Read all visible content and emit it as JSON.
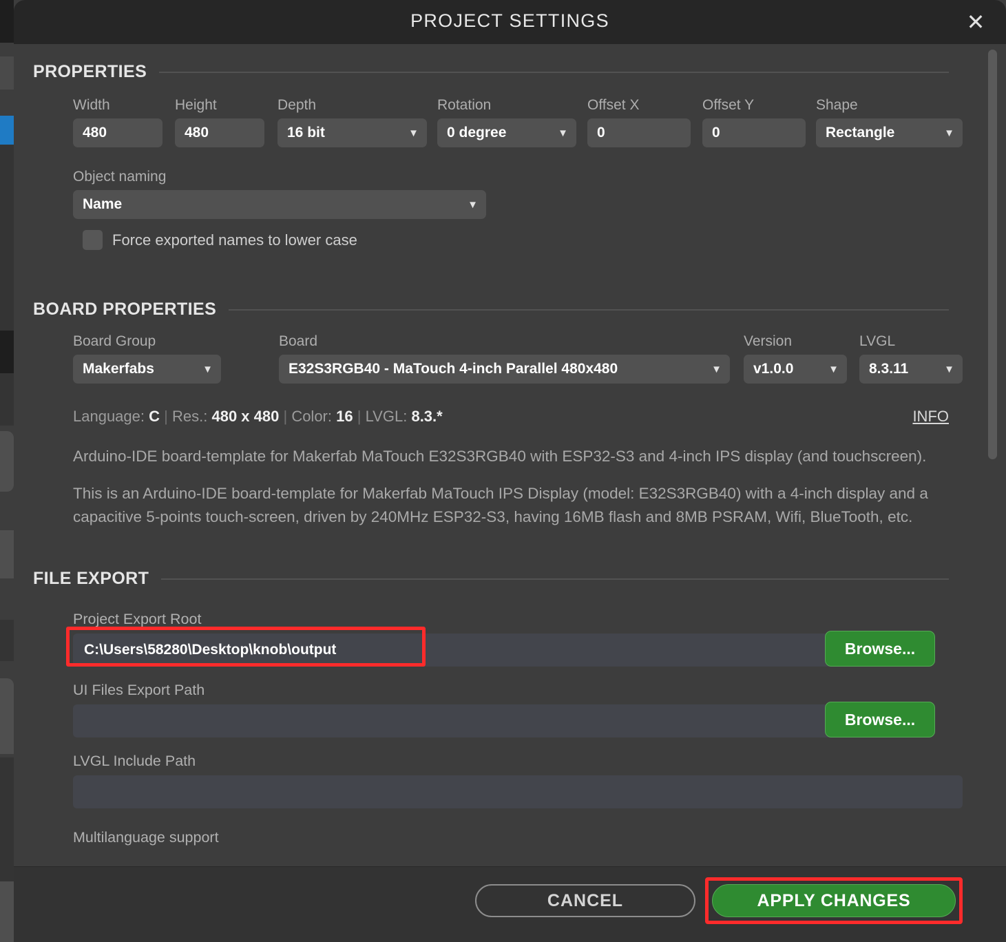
{
  "dialog": {
    "title": "PROJECT SETTINGS",
    "close_icon": "close-icon"
  },
  "properties": {
    "section_title": "PROPERTIES",
    "fields": [
      {
        "label": "Width",
        "value": "480",
        "type": "input"
      },
      {
        "label": "Height",
        "value": "480",
        "type": "input"
      },
      {
        "label": "Depth",
        "value": "16 bit",
        "type": "select"
      },
      {
        "label": "Rotation",
        "value": "0 degree",
        "type": "select"
      },
      {
        "label": "Offset X",
        "value": "0",
        "type": "input"
      },
      {
        "label": "Offset Y",
        "value": "0",
        "type": "input"
      },
      {
        "label": "Shape",
        "value": "Rectangle",
        "type": "select"
      }
    ],
    "object_naming": {
      "label": "Object naming",
      "value": "Name"
    },
    "force_lower_case": {
      "label": "Force exported names to lower case",
      "checked": false
    }
  },
  "board_properties": {
    "section_title": "BOARD PROPERTIES",
    "fields": [
      {
        "label": "Board Group",
        "value": "Makerfabs"
      },
      {
        "label": "Board",
        "value": "E32S3RGB40 - MaTouch 4-inch Parallel 480x480"
      },
      {
        "label": "Version",
        "value": "v1.0.0"
      },
      {
        "label": "LVGL",
        "value": "8.3.11"
      }
    ],
    "meta": {
      "language_key": "Language:",
      "language_value": "C",
      "res_key": "Res.:",
      "res_value": "480 x 480",
      "color_key": "Color:",
      "color_value": "16",
      "lvgl_key": "LVGL:",
      "lvgl_value": "8.3.*",
      "separator": "|"
    },
    "info_link": "INFO",
    "description_1": "Arduino-IDE board-template for Makerfab MaTouch E32S3RGB40 with ESP32-S3 and 4-inch IPS display (and touchscreen).",
    "description_2": "This is an Arduino-IDE board-template for Makerfab MaTouch IPS Display (model: E32S3RGB40) with a 4-inch display and a capacitive 5-points touch-screen, driven by 240MHz ESP32-S3, having 16MB flash and 8MB PSRAM, Wifi, BlueTooth, etc."
  },
  "file_export": {
    "section_title": "FILE EXPORT",
    "project_export_root": {
      "label": "Project Export Root",
      "value": "C:\\Users\\58280\\Desktop\\knob\\output",
      "placeholder": "",
      "browse_label": "Browse..."
    },
    "ui_files_export_path": {
      "label": "UI Files Export Path",
      "value": "",
      "placeholder": "",
      "browse_label": "Browse..."
    },
    "lvgl_include_path": {
      "label": "LVGL Include Path",
      "value": "",
      "placeholder": ""
    },
    "multilanguage_support": {
      "label": "Multilanguage support"
    }
  },
  "footer": {
    "cancel_label": "CANCEL",
    "apply_label": "APPLY CHANGES"
  },
  "colors": {
    "highlight": "#ff2b2b",
    "accent_green": "#2f8b31",
    "dialog_bg": "#3d3d3d",
    "titlebar_bg": "#262626",
    "field_bg": "#515151",
    "path_field_bg": "#43454c"
  }
}
